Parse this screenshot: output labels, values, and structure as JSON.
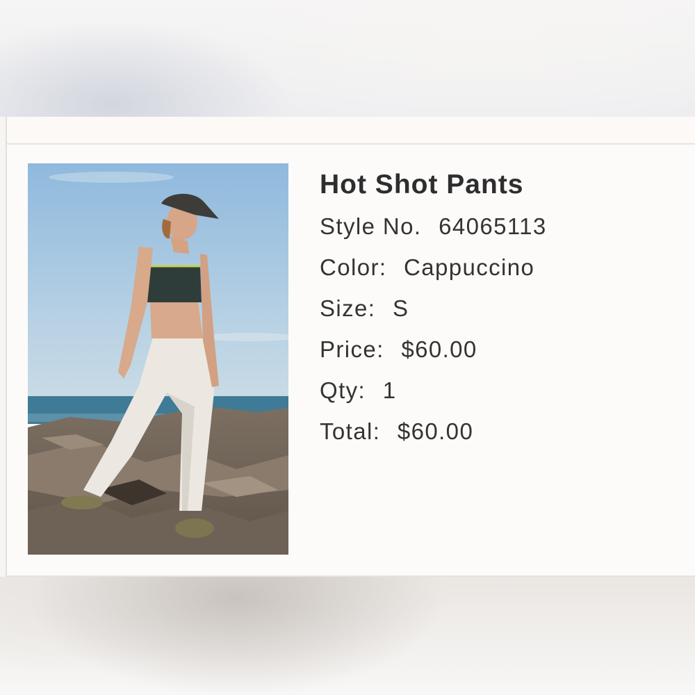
{
  "product": {
    "title": "Hot Shot Pants",
    "style_label": "Style No.",
    "style_value": "64065113",
    "color_label": "Color:",
    "color_value": "Cappuccino",
    "size_label": "Size:",
    "size_value": "S",
    "price_label": "Price:",
    "price_value": "$60.00",
    "qty_label": "Qty:",
    "qty_value": "1",
    "total_label": "Total:",
    "total_value": "$60.00"
  },
  "image": {
    "description_icon": "product-photo"
  }
}
